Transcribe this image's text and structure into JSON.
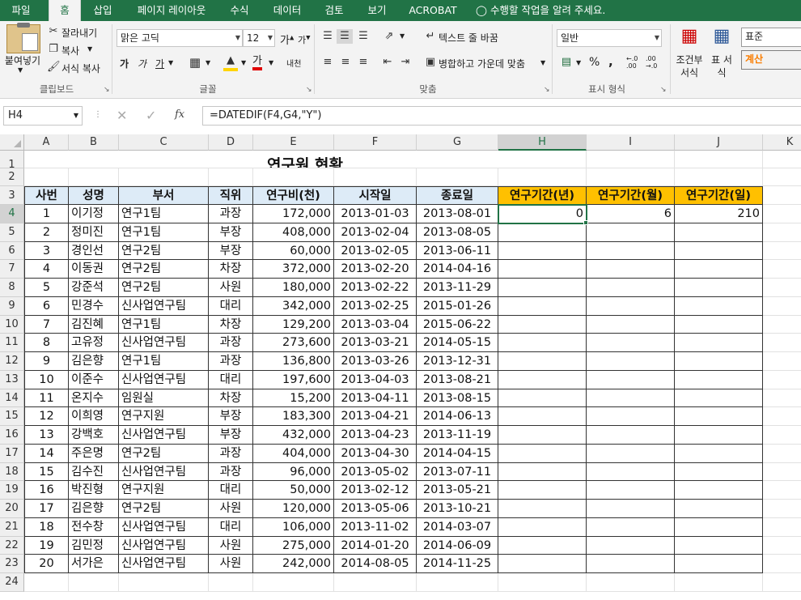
{
  "tabs": [
    "파일",
    "홈",
    "삽입",
    "페이지 레이아웃",
    "수식",
    "데이터",
    "검토",
    "보기",
    "ACROBAT"
  ],
  "tell_me": "수행할 작업을 알려 주세요.",
  "clipboard": {
    "paste": "붙여넣기",
    "cut": "잘라내기",
    "copy": "복사",
    "format_painter": "서식 복사",
    "label": "클립보드"
  },
  "font": {
    "name": "맑은 고딕",
    "size": "12",
    "bold": "가",
    "italic": "가",
    "underline": "가",
    "grow": "가",
    "shrink": "가",
    "color_glyph": "가",
    "phonetic": "내천",
    "label": "글꼴"
  },
  "alignment": {
    "wrap": "텍스트 줄 바꿈",
    "merge": "병합하고 가운데 맞춤",
    "label": "맞춤"
  },
  "number": {
    "format": "일반",
    "percent": "%",
    "comma": ",",
    "inc_decimal": "←.0 .00",
    "dec_decimal": ".00 →.0",
    "label": "표시 형식"
  },
  "styles": {
    "conditional": "조건부 서식",
    "table": "표 서식",
    "normal": "표준",
    "calculation": "계산"
  },
  "accent": "#217346",
  "formula_bar": {
    "namebox": "H4",
    "fx": "fx",
    "formula": "=DATEDIF(F4,G4,\"Y\")"
  },
  "columns": [
    "A",
    "B",
    "C",
    "D",
    "E",
    "F",
    "G",
    "H",
    "I",
    "J",
    "K"
  ],
  "rows": [
    "1",
    "2",
    "3",
    "4",
    "5",
    "6",
    "7",
    "8",
    "9",
    "10",
    "11",
    "12",
    "13",
    "14",
    "15",
    "16",
    "17",
    "18",
    "19",
    "20",
    "21",
    "22",
    "23",
    "24"
  ],
  "sheet": {
    "title": "연구원 현황",
    "headers": [
      "사번",
      "성명",
      "부서",
      "직위",
      "연구비(천)",
      "시작일",
      "종료일",
      "연구기간(년)",
      "연구기간(월)",
      "연구기간(일)"
    ],
    "records": [
      [
        "1",
        "이기정",
        "연구1팀",
        "과장",
        "172,000",
        "2013-01-03",
        "2013-08-01",
        "0",
        "6",
        "210"
      ],
      [
        "2",
        "정미진",
        "연구1팀",
        "부장",
        "408,000",
        "2013-02-04",
        "2013-08-05",
        "",
        "",
        ""
      ],
      [
        "3",
        "경인선",
        "연구2팀",
        "부장",
        "60,000",
        "2013-02-05",
        "2013-06-11",
        "",
        "",
        ""
      ],
      [
        "4",
        "이동권",
        "연구2팀",
        "차장",
        "372,000",
        "2013-02-20",
        "2014-04-16",
        "",
        "",
        ""
      ],
      [
        "5",
        "강준석",
        "연구2팀",
        "사원",
        "180,000",
        "2013-02-22",
        "2013-11-29",
        "",
        "",
        ""
      ],
      [
        "6",
        "민경수",
        "신사업연구팀",
        "대리",
        "342,000",
        "2013-02-25",
        "2015-01-26",
        "",
        "",
        ""
      ],
      [
        "7",
        "김진혜",
        "연구1팀",
        "차장",
        "129,200",
        "2013-03-04",
        "2015-06-22",
        "",
        "",
        ""
      ],
      [
        "8",
        "고유정",
        "신사업연구팀",
        "과장",
        "273,600",
        "2013-03-21",
        "2014-05-15",
        "",
        "",
        ""
      ],
      [
        "9",
        "김은향",
        "연구1팀",
        "과장",
        "136,800",
        "2013-03-26",
        "2013-12-31",
        "",
        "",
        ""
      ],
      [
        "10",
        "이준수",
        "신사업연구팀",
        "대리",
        "197,600",
        "2013-04-03",
        "2013-08-21",
        "",
        "",
        ""
      ],
      [
        "11",
        "온지수",
        "임원실",
        "차장",
        "15,200",
        "2013-04-11",
        "2013-08-15",
        "",
        "",
        ""
      ],
      [
        "12",
        "이희영",
        "연구지원",
        "부장",
        "183,300",
        "2013-04-21",
        "2014-06-13",
        "",
        "",
        ""
      ],
      [
        "13",
        "강백호",
        "신사업연구팀",
        "부장",
        "432,000",
        "2013-04-23",
        "2013-11-19",
        "",
        "",
        ""
      ],
      [
        "14",
        "주은명",
        "연구2팀",
        "과장",
        "404,000",
        "2013-04-30",
        "2014-04-15",
        "",
        "",
        ""
      ],
      [
        "15",
        "김수진",
        "신사업연구팀",
        "과장",
        "96,000",
        "2013-05-02",
        "2013-07-11",
        "",
        "",
        ""
      ],
      [
        "16",
        "박진형",
        "연구지원",
        "대리",
        "50,000",
        "2013-02-12",
        "2013-05-21",
        "",
        "",
        ""
      ],
      [
        "17",
        "김은향",
        "연구2팀",
        "사원",
        "120,000",
        "2013-05-06",
        "2013-10-21",
        "",
        "",
        ""
      ],
      [
        "18",
        "전수창",
        "신사업연구팀",
        "대리",
        "106,000",
        "2013-11-02",
        "2014-03-07",
        "",
        "",
        ""
      ],
      [
        "19",
        "김민정",
        "신사업연구팀",
        "사원",
        "275,000",
        "2014-01-20",
        "2014-06-09",
        "",
        "",
        ""
      ],
      [
        "20",
        "서가은",
        "신사업연구팀",
        "사원",
        "242,000",
        "2014-08-05",
        "2014-11-25",
        "",
        "",
        ""
      ]
    ]
  },
  "colors": {
    "header_fill": "#ddebf7",
    "header_highlight": "#ffc000",
    "calc_text": "#fa7d00"
  }
}
